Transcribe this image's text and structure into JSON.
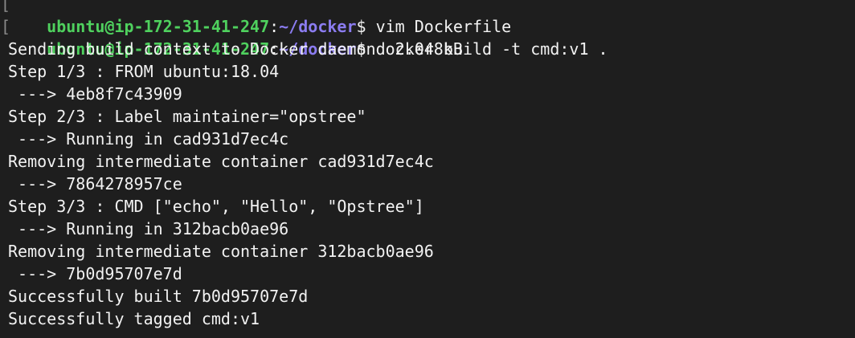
{
  "prompts": [
    {
      "user_host": "ubuntu@ip-172-31-41-247",
      "separator": ":",
      "path": "~/docker",
      "symbol": "$ ",
      "command": "vim Dockerfile"
    },
    {
      "user_host": "ubuntu@ip-172-31-41-247",
      "separator": ":",
      "path": "~/docker",
      "symbol": "$ ",
      "command": "docker build -t cmd:v1 ."
    }
  ],
  "prompt_bracket": "[",
  "output": [
    "Sending build context to Docker daemon  2.048kB",
    "Step 1/3 : FROM ubuntu:18.04",
    " ---> 4eb8f7c43909",
    "Step 2/3 : Label maintainer=\"opstree\"",
    " ---> Running in cad931d7ec4c",
    "Removing intermediate container cad931d7ec4c",
    " ---> 7864278957ce",
    "Step 3/3 : CMD [\"echo\", \"Hello\", \"Opstree\"]",
    " ---> Running in 312bacb0ae96",
    "Removing intermediate container 312bacb0ae96",
    " ---> 7b0d95707e7d",
    "Successfully built 7b0d95707e7d",
    "Successfully tagged cmd:v1"
  ],
  "colors": {
    "background": "#1e1e1e",
    "text": "#f2f2f2",
    "user_host": "#4fd15e",
    "path": "#8b7cf0"
  }
}
